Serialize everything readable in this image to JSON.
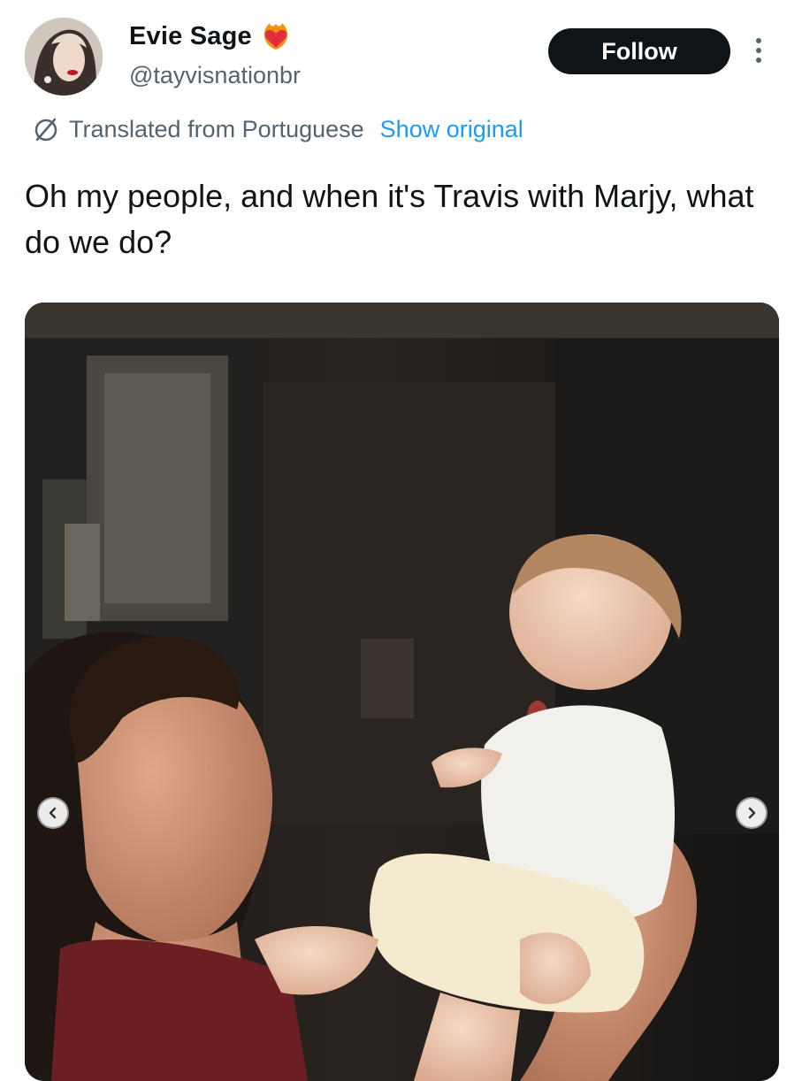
{
  "author": {
    "display_name": "Evie Sage",
    "handle": "@tayvisnationbr",
    "badge_icon": "heart-on-fire-icon"
  },
  "actions": {
    "follow_label": "Follow",
    "more_icon": "more-vertical-icon"
  },
  "translation": {
    "icon": "translate-icon",
    "label": "Translated from Portuguese",
    "show_original_label": "Show original"
  },
  "tweet": {
    "text": "Oh my people, and when it's Travis with Marjy, what do we do?"
  },
  "media": {
    "prev_icon": "chevron-left-icon",
    "next_icon": "chevron-right-icon"
  },
  "colors": {
    "accent": "#1d9bf0",
    "text_primary": "#0f1419",
    "text_secondary": "#536471",
    "follow_bg": "#0f1419"
  }
}
